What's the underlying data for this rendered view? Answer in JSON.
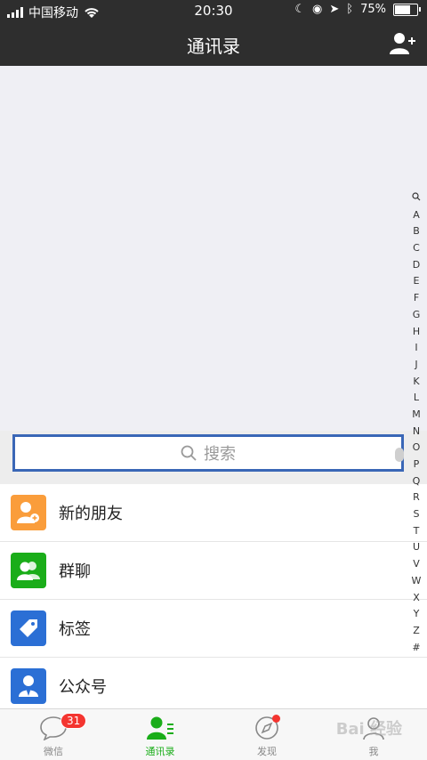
{
  "status": {
    "carrier": "中国移动",
    "time": "20:30",
    "battery": "75%",
    "battery_level": 0.75
  },
  "nav": {
    "title": "通讯录"
  },
  "search": {
    "placeholder": "搜索"
  },
  "items": [
    {
      "label": "新的朋友",
      "color": "#fa9d3b",
      "icon": "new-friend-icon"
    },
    {
      "label": "群聊",
      "color": "#1aad19",
      "icon": "group-chat-icon"
    },
    {
      "label": "标签",
      "color": "#2b6fd5",
      "icon": "tag-icon"
    },
    {
      "label": "公众号",
      "color": "#2b6fd5",
      "icon": "official-account-icon"
    }
  ],
  "index": [
    "A",
    "B",
    "C",
    "D",
    "E",
    "F",
    "G",
    "H",
    "I",
    "J",
    "K",
    "L",
    "M",
    "N",
    "O",
    "P",
    "Q",
    "R",
    "S",
    "T",
    "U",
    "V",
    "W",
    "X",
    "Y",
    "Z",
    "#"
  ],
  "tabs": [
    {
      "label": "微信",
      "badge": "31"
    },
    {
      "label": "通讯录"
    },
    {
      "label": "发现"
    },
    {
      "label": "我"
    }
  ],
  "accent": "#1aad19",
  "watermark": "Bai 经验"
}
